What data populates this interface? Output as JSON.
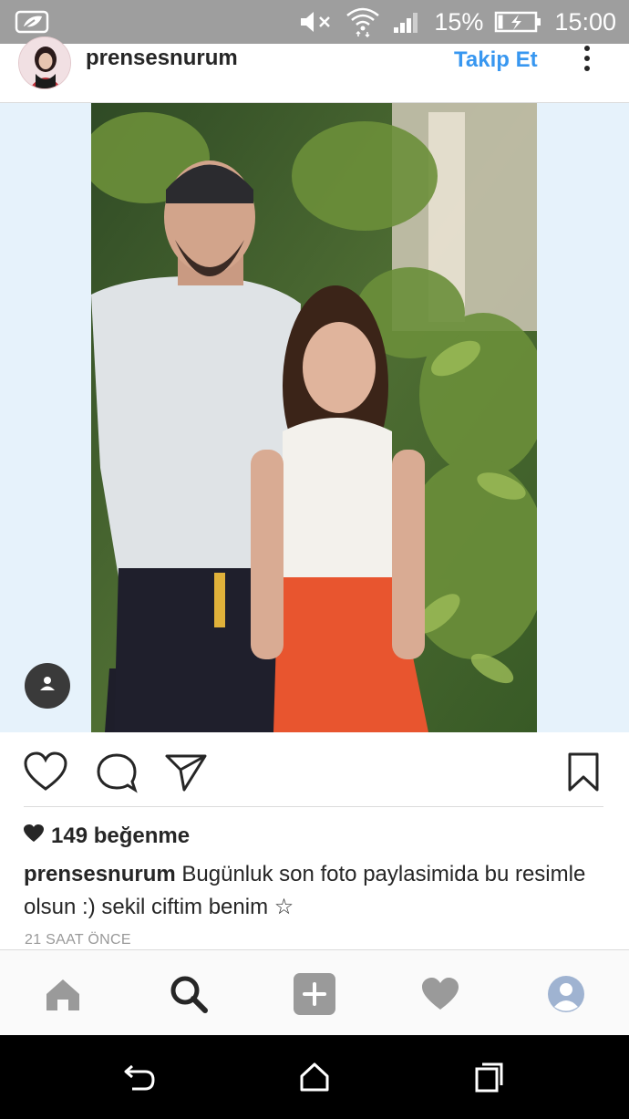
{
  "status_bar": {
    "battery_percent": "15%",
    "time": "15:00",
    "icons": [
      "notification-leaf-icon",
      "mute-icon",
      "wifi-icon",
      "signal-icon",
      "battery-charging-icon"
    ]
  },
  "post": {
    "username": "prensesnurum",
    "follow_label": "Takip Et",
    "likes": "149 beğenme",
    "caption_user": "prensesnurum",
    "caption_text": " Bugünluk son foto paylasimida bu resimle olsun :) sekil ciftim benim ☆",
    "time_ago": "21 SAAT ÖNCE"
  },
  "actions": [
    "like-icon",
    "comment-icon",
    "share-icon",
    "bookmark-icon"
  ],
  "bottom_nav": [
    "home-icon",
    "search-icon",
    "add-icon",
    "activity-heart-icon",
    "profile-icon"
  ],
  "system_nav": [
    "back-icon",
    "home-icon",
    "recents-icon"
  ],
  "colors": {
    "status_bar": "#9e9e9e",
    "accent_blue": "#3897f0",
    "photo_background": "#e6f2fb",
    "text": "#262626",
    "muted": "#999999"
  }
}
